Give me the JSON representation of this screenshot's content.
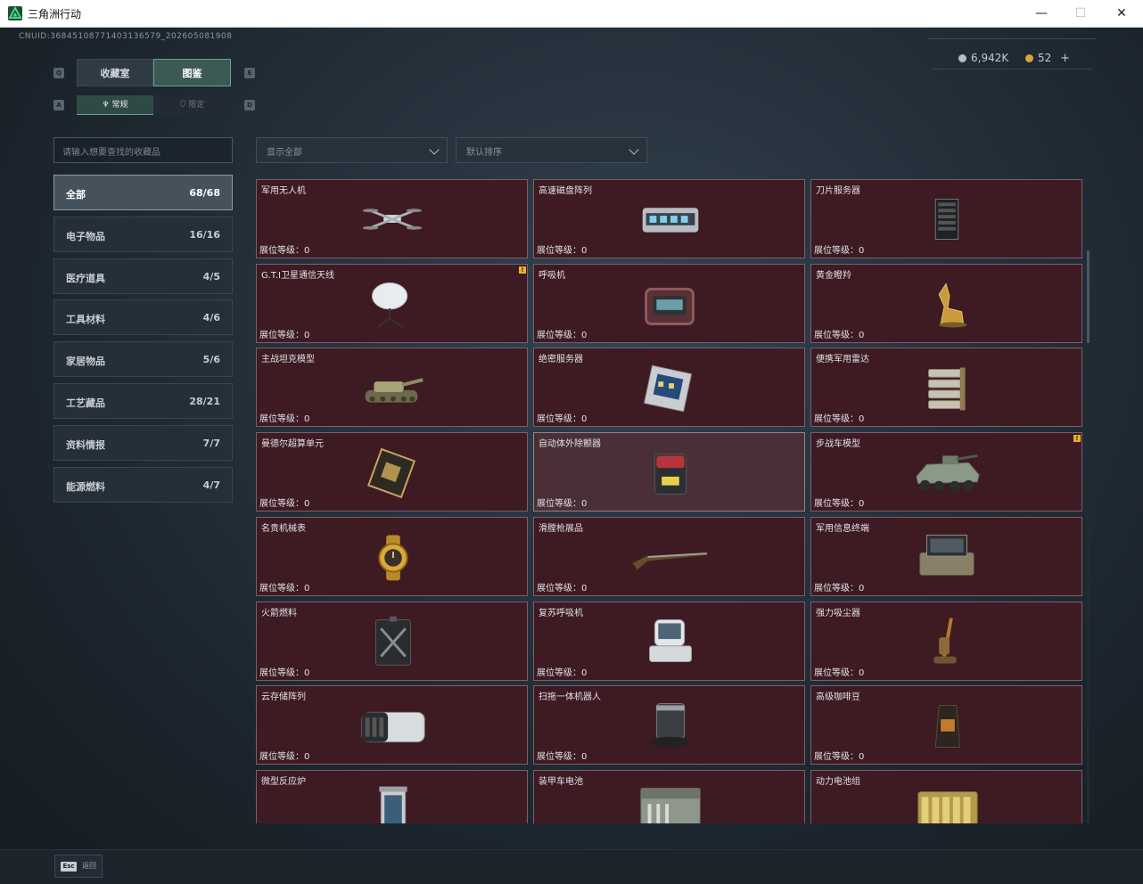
{
  "window": {
    "title": "三角洲行动",
    "minimize_glyph": "—",
    "maximize_glyph": "☐",
    "close_glyph": "✕"
  },
  "header": {
    "uid": "CNUID:36845108771403136579_202605081908"
  },
  "currency": {
    "silver_value": "6,942K",
    "gold_value": "52",
    "add_glyph": "+",
    "silver_color": "#b9bec4",
    "gold_color": "#d7a640"
  },
  "tabs": {
    "left_key": "Q",
    "right_key": "E",
    "items": [
      {
        "label": "收藏室"
      },
      {
        "label": "图鉴"
      }
    ],
    "active": 1
  },
  "subtabs": {
    "left_key": "A",
    "right_key": "D",
    "items": [
      {
        "label": "常规"
      },
      {
        "label": "限定"
      }
    ],
    "active": 0
  },
  "search": {
    "placeholder": "请输入想要查找的收藏品"
  },
  "filters": {
    "display": "显示全部",
    "sort": "默认排序"
  },
  "categories": [
    {
      "name": "全部",
      "count": "68/68"
    },
    {
      "name": "电子物品",
      "count": "16/16"
    },
    {
      "name": "医疗道具",
      "count": "4/5"
    },
    {
      "name": "工具材料",
      "count": "4/6"
    },
    {
      "name": "家居物品",
      "count": "5/6"
    },
    {
      "name": "工艺藏品",
      "count": "28/21"
    },
    {
      "name": "资料情报",
      "count": "7/7"
    },
    {
      "name": "能源燃料",
      "count": "4/7"
    }
  ],
  "level_label": "展位等级：",
  "items": [
    {
      "name": "军用无人机",
      "level": "0",
      "icon": "drone-icon"
    },
    {
      "name": "高速磁盘阵列",
      "level": "0",
      "icon": "disk-array-icon"
    },
    {
      "name": "刀片服务器",
      "level": "0",
      "icon": "blade-server-icon"
    },
    {
      "name": "G.T.I卫星通信天线",
      "level": "0",
      "icon": "satellite-dish-icon",
      "warn": "!"
    },
    {
      "name": "呼吸机",
      "level": "0",
      "icon": "ventilator-icon"
    },
    {
      "name": "黄金瞪羚",
      "level": "0",
      "icon": "golden-gazelle-icon"
    },
    {
      "name": "主战坦克模型",
      "level": "0",
      "icon": "tank-model-icon"
    },
    {
      "name": "绝密服务器",
      "level": "0",
      "icon": "secret-server-icon"
    },
    {
      "name": "便携军用雷达",
      "level": "0",
      "icon": "radar-icon"
    },
    {
      "name": "曼德尔超算单元",
      "level": "0",
      "icon": "compute-unit-icon"
    },
    {
      "name": "自动体外除颤器",
      "level": "0",
      "icon": "defibrillator-icon",
      "highlight": true
    },
    {
      "name": "步战车模型",
      "level": "0",
      "icon": "ifv-model-icon",
      "warn": "!"
    },
    {
      "name": "名贵机械表",
      "level": "0",
      "icon": "watch-icon"
    },
    {
      "name": "滑膛枪展品",
      "level": "0",
      "icon": "musket-icon"
    },
    {
      "name": "军用信息终端",
      "level": "0",
      "icon": "terminal-icon"
    },
    {
      "name": "火箭燃料",
      "level": "0",
      "icon": "fuel-can-icon"
    },
    {
      "name": "复苏呼吸机",
      "level": "0",
      "icon": "resuscitator-icon"
    },
    {
      "name": "强力吸尘器",
      "level": "0",
      "icon": "vacuum-icon"
    },
    {
      "name": "云存储阵列",
      "level": "0",
      "icon": "cloud-storage-icon"
    },
    {
      "name": "扫拖一体机器人",
      "level": "0",
      "icon": "robot-mop-icon"
    },
    {
      "name": "高级咖啡豆",
      "level": "0",
      "icon": "coffee-bag-icon"
    },
    {
      "name": "微型反应炉",
      "level": "",
      "icon": "reactor-icon"
    },
    {
      "name": "装甲车电池",
      "level": "",
      "icon": "battery-icon"
    },
    {
      "name": "动力电池组",
      "level": "",
      "icon": "battery-pack-icon"
    }
  ],
  "footer": {
    "esc_key": "Esc",
    "esc_label": "返回"
  }
}
